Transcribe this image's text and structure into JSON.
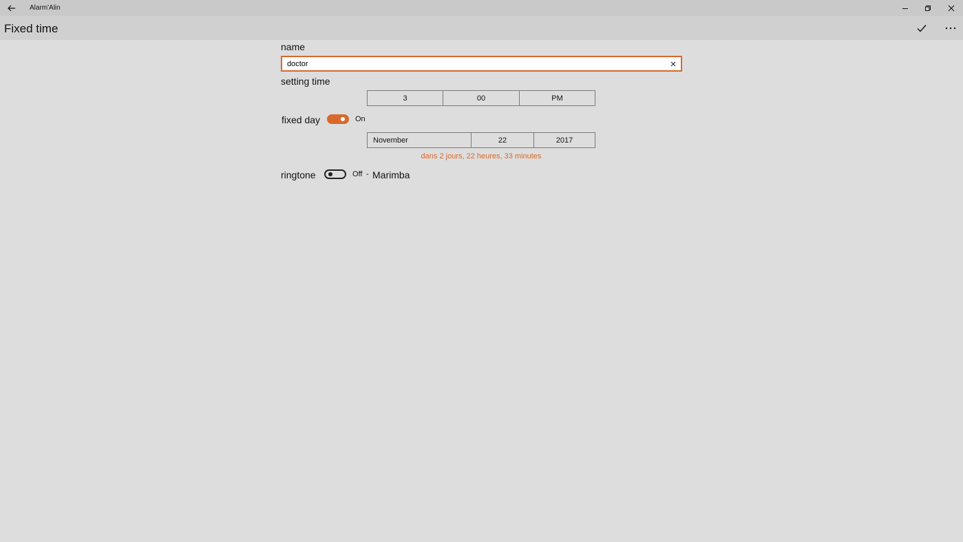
{
  "window": {
    "title": "Alarm'Alin"
  },
  "header": {
    "title": "Fixed time"
  },
  "name": {
    "label": "name",
    "value": "doctor"
  },
  "setting_time": {
    "label": "setting time",
    "hour": "3",
    "minute": "00",
    "period": "PM"
  },
  "fixed_day": {
    "label": "fixed day",
    "toggle_on": true,
    "state_text": "On",
    "month": "November",
    "day": "22",
    "year": "2017",
    "countdown": "dans 2 jours, 22 heures, 33 minutes"
  },
  "ringtone": {
    "label": "ringtone",
    "toggle_on": false,
    "state_text": "Off",
    "separator": "-",
    "name": "Marimba"
  },
  "colors": {
    "accent": "#d9692b",
    "background": "#dddddd",
    "titlebar": "#c9c9c9",
    "headerbar": "#d0d0d0"
  }
}
